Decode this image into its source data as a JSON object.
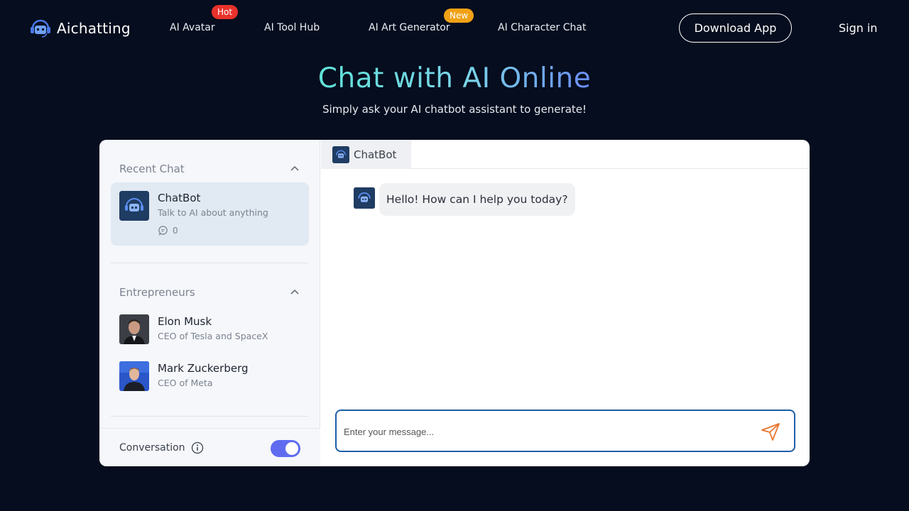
{
  "header": {
    "logo_text": "Aichatting",
    "nav": [
      {
        "label": "AI Avatar",
        "badge": "Hot"
      },
      {
        "label": "AI Tool Hub"
      },
      {
        "label": "AI Art Generator",
        "badge": "New"
      },
      {
        "label": "AI Character Chat"
      }
    ],
    "download_label": "Download App",
    "signin_label": "Sign in"
  },
  "hero": {
    "title": "Chat with AI Online",
    "subtitle": "Simply ask your AI chatbot assistant to generate!"
  },
  "sidebar": {
    "recent_heading": "Recent Chat",
    "recent_chats": [
      {
        "name": "ChatBot",
        "description": "Talk to AI about anything",
        "count": "0"
      }
    ],
    "entrepreneurs_heading": "Entrepreneurs",
    "entrepreneurs": [
      {
        "name": "Elon Musk",
        "description": "CEO of Tesla and SpaceX"
      },
      {
        "name": "Mark Zuckerberg",
        "description": "CEO of Meta"
      }
    ],
    "conversation_label": "Conversation",
    "conversation_enabled": true
  },
  "chat": {
    "tab_label": "ChatBot",
    "messages": [
      {
        "from": "bot",
        "text": "Hello! How can I help you today?"
      }
    ],
    "input_placeholder": "Enter your message..."
  },
  "colors": {
    "background": "#050d1e",
    "accent": "#5f6cf0",
    "send_icon": "#e8772e",
    "hot_badge": "#e8322b",
    "new_badge": "#f0a116"
  },
  "icons": [
    "robot-headset-icon",
    "chevron-up-icon",
    "comment-icon",
    "info-icon",
    "send-icon"
  ]
}
